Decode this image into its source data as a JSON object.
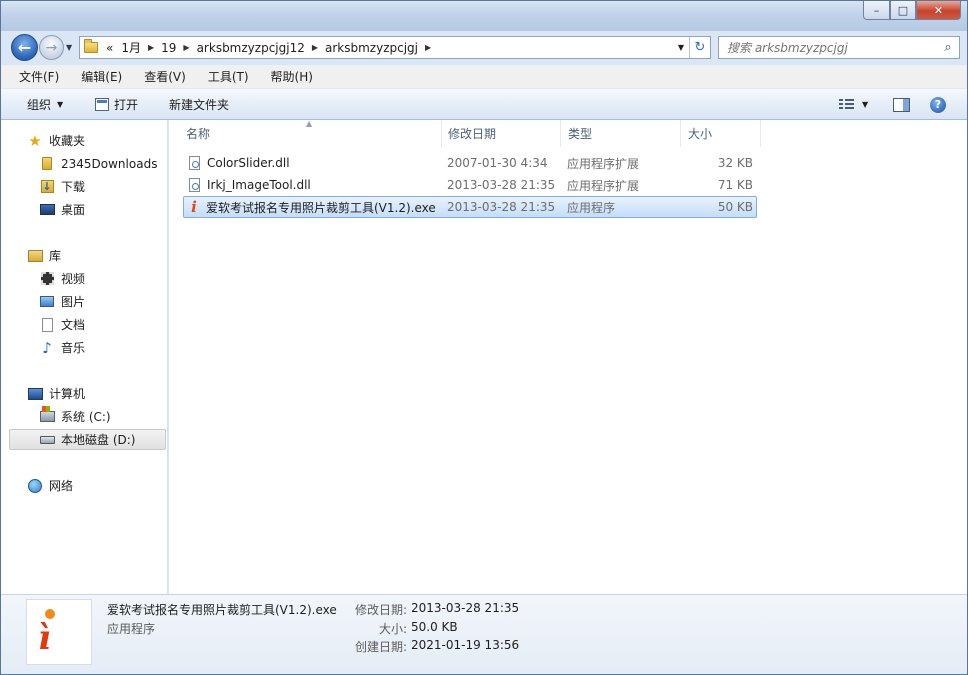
{
  "window": {
    "minimize_glyph": "–",
    "maximize_glyph": "□",
    "close_glyph": "✕"
  },
  "nav": {
    "back_glyph": "←",
    "forward_glyph": "→",
    "breadcrumbs": [
      "«",
      "1月",
      "19",
      "arksbmzyzpcjgj12",
      "arksbmzyzpcjgj"
    ],
    "search_placeholder": "搜索 arksbmzyzpcjgj"
  },
  "menu": [
    "文件(F)",
    "编辑(E)",
    "查看(V)",
    "工具(T)",
    "帮助(H)"
  ],
  "toolbar": {
    "organize": "组织",
    "open": "打开",
    "new_folder": "新建文件夹",
    "help_glyph": "?"
  },
  "navpane": {
    "favorites": "收藏夹",
    "fav_items": [
      "2345Downloads",
      "下载",
      "桌面"
    ],
    "libraries": "库",
    "lib_items": [
      "视频",
      "图片",
      "文档",
      "音乐"
    ],
    "computer": "计算机",
    "drives": [
      "系统 (C:)",
      "本地磁盘 (D:)"
    ],
    "selected_drive": "本地磁盘 (D:)",
    "network": "网络"
  },
  "columns": [
    "名称",
    "修改日期",
    "类型",
    "大小"
  ],
  "files": [
    {
      "name": "ColorSlider.dll",
      "modified": "2007-01-30 4:34",
      "type": "应用程序扩展",
      "size": "32 KB"
    },
    {
      "name": "Irkj_ImageTool.dll",
      "modified": "2013-03-28 21:35",
      "type": "应用程序扩展",
      "size": "71 KB"
    },
    {
      "name": "爱软考试报名专用照片裁剪工具(V1.2).exe",
      "modified": "2013-03-28 21:35",
      "type": "应用程序",
      "size": "50 KB"
    }
  ],
  "details": {
    "name": "爱软考试报名专用照片裁剪工具(V1.2).exe",
    "type": "应用程序",
    "modified_label": "修改日期:",
    "modified": "2013-03-28 21:35",
    "size_label": "大小:",
    "size": "50.0 KB",
    "created_label": "创建日期:",
    "created": "2021-01-19 13:56"
  },
  "colors": {
    "selection": "#c4ddfa",
    "selection_border": "#84acdd",
    "window_frame": "#c1d3ea",
    "exe_logo": "#e03a10"
  }
}
